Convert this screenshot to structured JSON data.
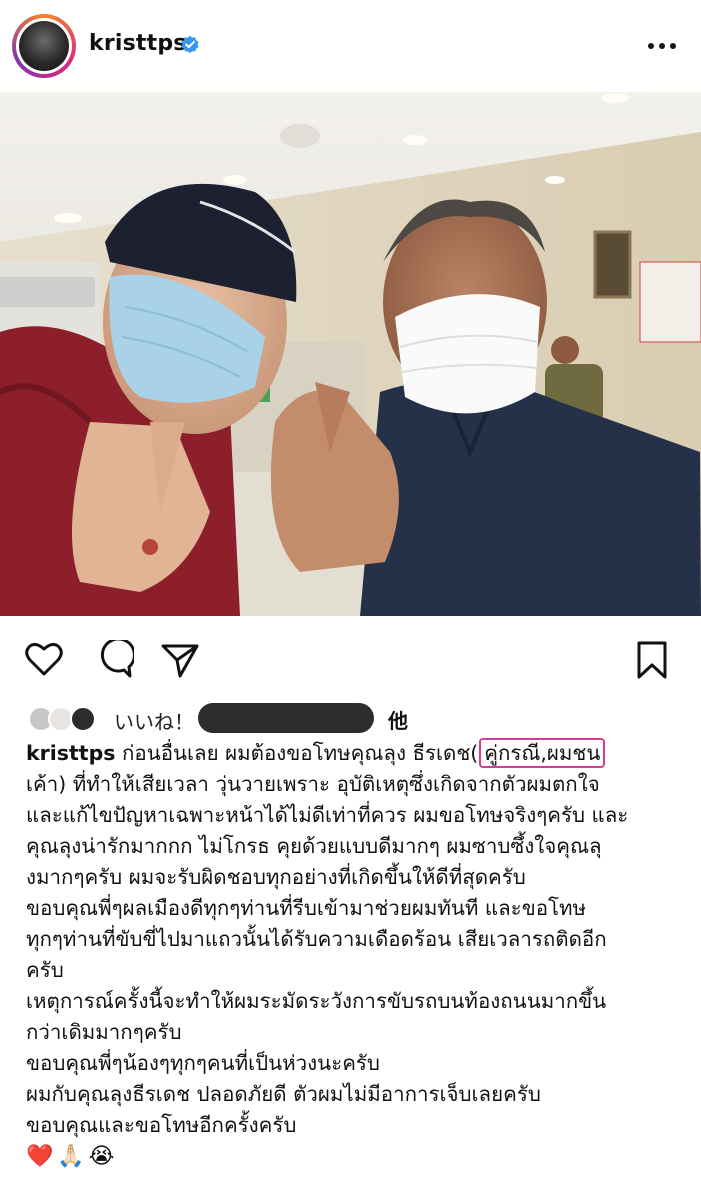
{
  "post": {
    "username": "kristtps",
    "verified": true
  },
  "likes": {
    "label": "いいね！",
    "suffix": "他"
  },
  "caption": {
    "username": "kristtps",
    "line1_text": " ก่อนอื่นเลย ผมต้องขอโทษคุณลุง ธีรเดช(",
    "line1_highlight": "คู่กรณี,ผมชน",
    "lines": [
      "เค้า) ที่ทำให้เสียเวลา วุ่นวายเพราะ อุบัติเหตุซึ่งเกิดจากตัวผมตกใจ",
      "และแก้ไขปัญหาเฉพาะหน้าได้ไม่ดีเท่าที่ควร ผมขอโทษจริงๆครับ และ",
      "คุณลุงน่ารักมากกก ไม่โกรธ คุยด้วยแบบดีมากๆ ผมซาบซึ้งใจคุณลุ",
      "งมากๆครับ ผมจะรับผิดชอบทุกอย่างที่เกิดขึ้นให้ดีที่สุดครับ",
      "ขอบคุณพี่ๆผลเมืองดีทุกๆท่านที่รีบเข้ามาช่วยผมทันที และขอโทษ",
      "ทุกๆท่านที่ขับขี่ไปมาแถวนั้นได้รับความเดือดร้อน เสียเวลารถติดอีก",
      "ครับ",
      "เหตุการณ์ครั้งนี้จะทำให้ผมระมัดระวังการขับรถบนท้องถนนมากขึ้น",
      "กว่าเดิมมากๆครับ",
      "ขอบคุณพี่ๆน้องๆทุกๆคนที่เป็นห่วงนะครับ",
      "ผมกับคุณลุงธีรเดช ปลอดภัยดี ตัวผมไม่มีอาการเจ็บเลยครับ",
      "ขอบคุณและขอโทษอีกครั้งครับ"
    ],
    "emojis": "❤️🙏🏻😭"
  },
  "icons": {
    "verified": "verified-badge-icon",
    "more": "more-options-icon",
    "like": "heart-icon",
    "comment": "comment-icon",
    "share": "share-icon",
    "save": "bookmark-icon"
  },
  "colors": {
    "verified": "#3897f0",
    "highlight_box": "#d63c8f",
    "redaction": "#2d2d2d"
  }
}
